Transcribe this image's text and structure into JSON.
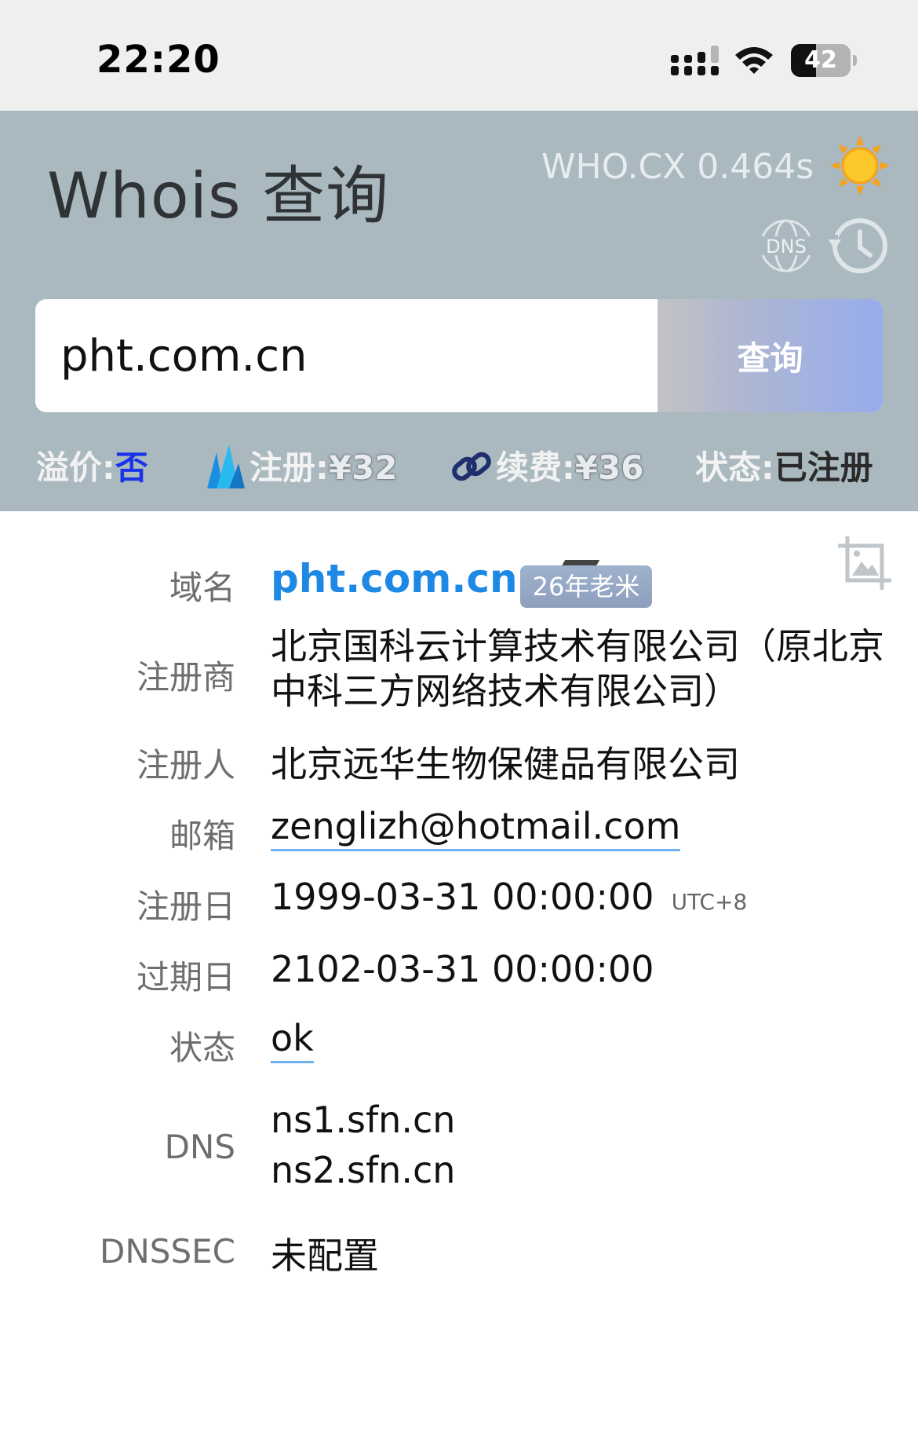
{
  "status_bar": {
    "time": "22:20",
    "battery": "42"
  },
  "header": {
    "title": "Whois 查询",
    "provider": "WHO.CX 0.464s",
    "search": {
      "value": "pht.com.cn",
      "button": "查询"
    },
    "info": {
      "premium_label": "溢价:",
      "premium_value": "否",
      "reg_label": "注册:",
      "reg_value": "¥32",
      "renew_label": "续费:",
      "renew_value": "¥36",
      "status_label": "状态:",
      "status_value": "已注册"
    }
  },
  "details": {
    "domain": {
      "label": "域名",
      "value": "pht.com.cn",
      "age": "26年老米"
    },
    "registrar": {
      "label": "注册商",
      "value": "北京国科云计算技术有限公司（原北京中科三方网络技术有限公司）"
    },
    "registrant": {
      "label": "注册人",
      "value": "北京远华生物保健品有限公司"
    },
    "email": {
      "label": "邮箱",
      "value": "zenglizh@hotmail.com"
    },
    "created": {
      "label": "注册日",
      "value": "1999-03-31 00:00:00",
      "tz": "UTC+8"
    },
    "expires": {
      "label": "过期日",
      "value": "2102-03-31 00:00:00"
    },
    "status": {
      "label": "状态",
      "value": "ok"
    },
    "dns": {
      "label": "DNS",
      "servers": [
        "ns1.sfn.cn",
        "ns2.sfn.cn"
      ]
    },
    "dnssec": {
      "label": "DNSSEC",
      "value": "未配置"
    }
  },
  "icons": [
    "signal-icon",
    "wifi-icon",
    "battery-icon",
    "sun-icon",
    "dns-icon",
    "history-icon",
    "registrar-logo-icon",
    "chain-link-icon",
    "screenshot-icon"
  ],
  "colors": {
    "header_bg": "#aab8bf",
    "domain_blue": "#1e88e5",
    "premium_blue": "#1a35e8",
    "button_gradient_end": "#97aced"
  }
}
